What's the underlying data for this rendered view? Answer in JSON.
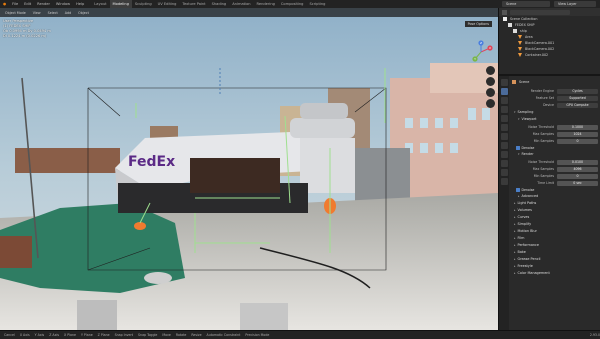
{
  "menu": [
    "File",
    "Edit",
    "Render",
    "Window",
    "Help"
  ],
  "workspaces": [
    {
      "label": "Layout",
      "active": false
    },
    {
      "label": "Modeling",
      "active": true
    },
    {
      "label": "Sculpting",
      "active": false
    },
    {
      "label": "UV Editing",
      "active": false
    },
    {
      "label": "Texture Paint",
      "active": false
    },
    {
      "label": "Shading",
      "active": false
    },
    {
      "label": "Animation",
      "active": false
    },
    {
      "label": "Rendering",
      "active": false
    },
    {
      "label": "Compositing",
      "active": false
    },
    {
      "label": "Scripting",
      "active": false
    }
  ],
  "scene_field": "Scene",
  "view_layer_field": "View Layer",
  "viewport": {
    "mode": "Object Mode",
    "header_buttons": [
      "View",
      "Select",
      "Add",
      "Object"
    ],
    "perspective": "User Perspective",
    "collection": "(1) FEDEX SHIP",
    "stat_line1": "Ob 0.0994 m  Dy 0.0494 m",
    "stat_line2": "Dl 0.1224 m (0.0226 m)",
    "pose_options": "Pose Options",
    "fedex_text": "FedEx",
    "gizmo_labels": {
      "x": "X",
      "y": "Y",
      "z": "Z"
    }
  },
  "status": [
    "Cancel",
    "X Axis",
    "Y Axis",
    "Z Axis",
    "X Plane",
    "Y Plane",
    "Z Plane",
    "Snap Invert",
    "Snap Toggle",
    "Move",
    "Rotate",
    "Resize",
    "Automatic Constraint",
    "Precision Mode"
  ],
  "version": "2.93.0",
  "outliner": {
    "title": "Scene Collection",
    "rows": [
      {
        "label": "FEDEX SHIP",
        "indent": 1
      },
      {
        "label": "ship",
        "indent": 2
      },
      {
        "label": "Area",
        "indent": 3
      },
      {
        "label": "BlackCamera.001",
        "indent": 3
      },
      {
        "label": "BlackCamera.002",
        "indent": 3
      },
      {
        "label": "Container.002",
        "indent": 3
      }
    ]
  },
  "properties": {
    "title": "Scene",
    "render_engine": {
      "label": "Render Engine",
      "value": "Cycles"
    },
    "feature_set": {
      "label": "Feature Set",
      "value": "Supported"
    },
    "device": {
      "label": "Device",
      "value": "GPU Compute"
    },
    "sampling": "Sampling",
    "viewport_sub": "Viewport",
    "vp_noise": {
      "label": "Noise Threshold",
      "value": "0.1000"
    },
    "vp_max": {
      "label": "Max Samples",
      "value": "1024"
    },
    "vp_min": {
      "label": "Min Samples",
      "value": "0"
    },
    "denoise1": "Denoise",
    "render_sub": "Render",
    "r_noise": {
      "label": "Noise Threshold",
      "value": "0.0100"
    },
    "r_max": {
      "label": "Max Samples",
      "value": "4096"
    },
    "r_min": {
      "label": "Min Samples",
      "value": "0"
    },
    "r_time": {
      "label": "Time Limit",
      "value": "0 sec"
    },
    "denoise2": "Denoise",
    "advanced": "Advanced",
    "sections": [
      "Light Paths",
      "Volumes",
      "Curves",
      "Simplify",
      "Motion Blur",
      "Film",
      "Performance",
      "Bake",
      "Grease Pencil",
      "Freestyle",
      "Color Management"
    ]
  }
}
